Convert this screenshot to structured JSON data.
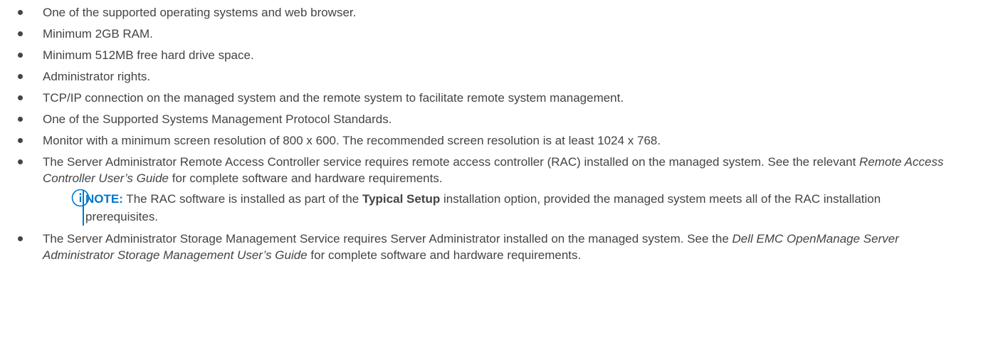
{
  "requirements": {
    "items": [
      "One of the supported operating systems and web browser.",
      "Minimum 2GB RAM.",
      "Minimum 512MB free hard drive space.",
      "Administrator rights.",
      "TCP/IP connection on the managed system and the remote system to facilitate remote system management.",
      "One of the Supported Systems Management Protocol Standards.",
      "Monitor with a minimum screen resolution of 800 x 600. The recommended screen resolution is at least 1024 x 768."
    ],
    "rac": {
      "before": "The Server Administrator Remote Access Controller service requires remote access controller (RAC) installed on the managed system. See the relevant ",
      "guide": "Remote Access Controller User’s Guide",
      "after": " for complete software and hardware requirements."
    },
    "note": {
      "icon": "info-icon",
      "label": "NOTE:",
      "before": " The RAC software is installed as part of the ",
      "bold": "Typical Setup",
      "after": " installation option, provided the managed system meets all of the RAC installation prerequisites."
    },
    "storage": {
      "before": "The Server Administrator Storage Management Service requires Server Administrator installed on the managed system. See the ",
      "guide": "Dell EMC OpenManage Server Administrator Storage Management User’s Guide",
      "after": " for complete software and hardware requirements."
    }
  },
  "colors": {
    "text": "#444444",
    "accent": "#0076ce"
  }
}
